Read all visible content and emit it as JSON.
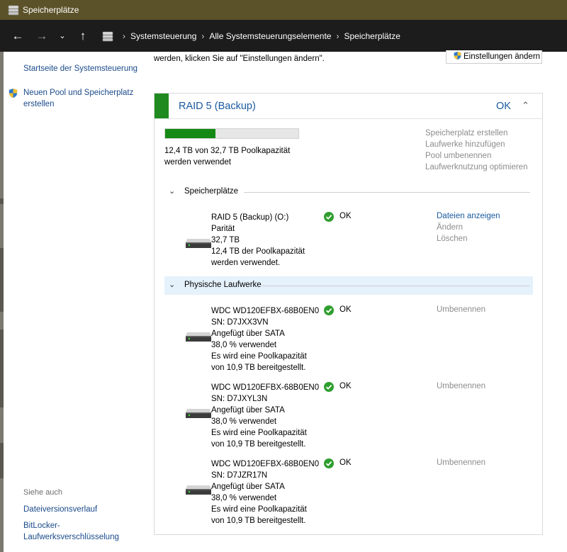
{
  "window": {
    "title": "Speicherplätze"
  },
  "address": {
    "crumbs": [
      "Systemsteuerung",
      "Alle Systemsteuerungselemente",
      "Speicherplätze"
    ]
  },
  "left_panel": {
    "home_link": "Startseite der Systemsteuerung",
    "new_pool_link": [
      "Neuen Pool und Speicherplatz",
      "erstellen"
    ],
    "see_also": "Siehe auch",
    "links": [
      "Dateiversionsverlauf",
      [
        "BitLocker-",
        "Laufwerksverschlüsselung"
      ]
    ]
  },
  "intro_text": "werden, klicken Sie auf \"Einstellungen ändern\".",
  "settings_button": "Einstellungen ändern",
  "pool": {
    "name": "RAID 5 (Backup)",
    "status": "OK",
    "capacity_used_fraction": 0.38,
    "capacity_text": [
      "12,4 TB von 32,7 TB Poolkapazität",
      "werden verwendet"
    ],
    "tasks": [
      "Speicherplatz erstellen",
      "Laufwerke hinzufügen",
      "Pool umbenennen",
      "Laufwerknutzung optimieren"
    ]
  },
  "spaces": {
    "section_label": "Speicherplätze",
    "items": [
      {
        "lines": [
          "RAID 5 (Backup) (O:)",
          "Parität",
          "32,7 TB",
          "12,4 TB der Poolkapazität",
          "werden verwendet."
        ],
        "status": "OK",
        "actions": [
          "Dateien anzeigen",
          "Ändern",
          "Löschen"
        ]
      }
    ]
  },
  "physical": {
    "section_label": "Physische Laufwerke",
    "items": [
      {
        "lines": [
          "WDC WD120EFBX-68B0EN0",
          "SN: D7JXX3VN",
          "Angefügt über SATA",
          "38,0 % verwendet",
          "Es wird eine Poolkapazität",
          "von 10,9 TB bereitgestellt."
        ],
        "status": "OK",
        "action": "Umbenennen"
      },
      {
        "lines": [
          "WDC WD120EFBX-68B0EN0",
          "SN: D7JXYL3N",
          "Angefügt über SATA",
          "38,0 % verwendet",
          "Es wird eine Poolkapazität",
          "von 10,9 TB bereitgestellt."
        ],
        "status": "OK",
        "action": "Umbenennen"
      },
      {
        "lines": [
          "WDC WD120EFBX-68B0EN0",
          "SN: D7JZR17N",
          "Angefügt über SATA",
          "38,0 % verwendet",
          "Es wird eine Poolkapazität",
          "von 10,9 TB bereitgestellt."
        ],
        "status": "OK",
        "action": "Umbenennen"
      }
    ]
  },
  "colors": {
    "accent_green": "#1f8a1f",
    "link_blue": "#1a5aa0",
    "title_bar": "#5c5229",
    "address_bar": "#1c1c1c"
  },
  "icons": {
    "app": "storage-spaces-icon",
    "ok": "check-circle-icon",
    "drive": "hard-drive-icon",
    "shield": "uac-shield-icon"
  }
}
